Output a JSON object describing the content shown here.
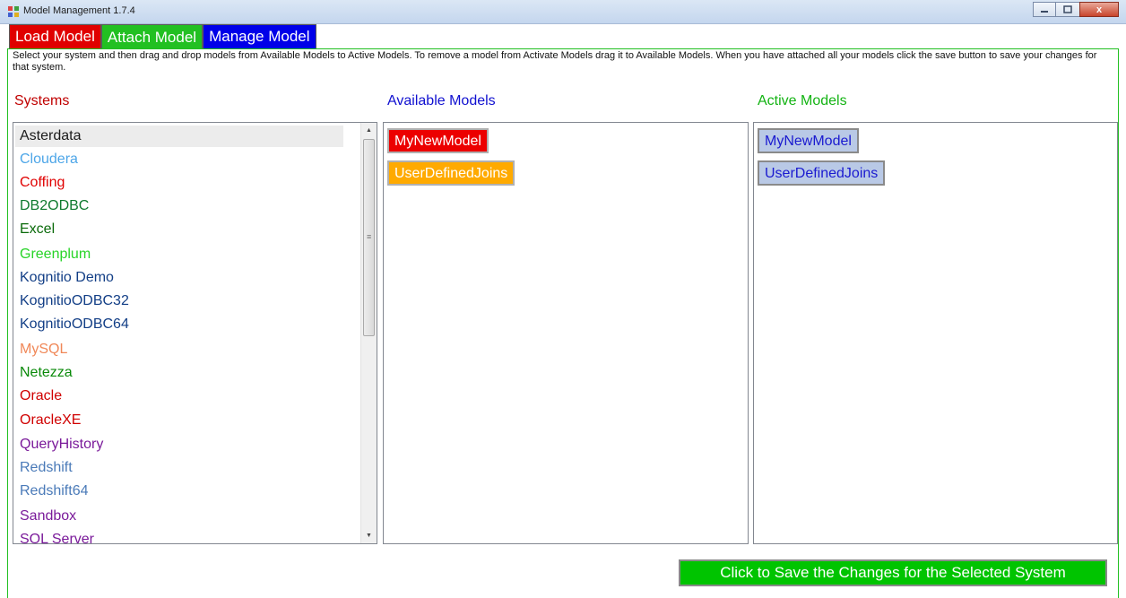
{
  "window": {
    "title": "Model Management 1.7.4",
    "minimize_icon": "minimize-icon",
    "maximize_icon": "maximize-icon",
    "close_icon": "close-icon",
    "close_label": "x"
  },
  "tabs": [
    {
      "label": "Load Model",
      "color": "#e00000"
    },
    {
      "label": "Attach Model",
      "color": "#22c022"
    },
    {
      "label": "Manage Model",
      "color": "#0000e8"
    }
  ],
  "instructions": "Select your system and then drag and drop models from Available Models to Active Models.  To remove a model from Activate Models drag it to Available Models.  When you have attached all your models click the save button to save your changes for that system.",
  "headers": {
    "systems": "Systems",
    "available": "Available Models",
    "active": "Active Models"
  },
  "systems": [
    {
      "label": "Asterdata",
      "color": "#1b1b1b",
      "selected": true
    },
    {
      "label": "Cloudera",
      "color": "#4da6e8"
    },
    {
      "label": "Coffing",
      "color": "#e00000"
    },
    {
      "label": "DB2ODBC",
      "color": "#0e7a2e"
    },
    {
      "label": "Excel",
      "color": "#0a6a0a"
    },
    {
      "label": "Greenplum",
      "color": "#28d428"
    },
    {
      "label": "Kognitio Demo",
      "color": "#123e86"
    },
    {
      "label": "KognitioODBC32",
      "color": "#123e86"
    },
    {
      "label": "KognitioODBC64",
      "color": "#123e86"
    },
    {
      "label": "MySQL",
      "color": "#f08858"
    },
    {
      "label": "Netezza",
      "color": "#0a8a0a"
    },
    {
      "label": "Oracle",
      "color": "#d00000"
    },
    {
      "label": "OracleXE",
      "color": "#d00000"
    },
    {
      "label": "QueryHistory",
      "color": "#7a1a9a"
    },
    {
      "label": "Redshift",
      "color": "#4a7ab8"
    },
    {
      "label": "Redshift64",
      "color": "#4a7ab8"
    },
    {
      "label": "Sandbox",
      "color": "#7a1a9a"
    },
    {
      "label": "SQL Server",
      "color": "#7a1a9a"
    }
  ],
  "available_models": [
    {
      "label": "MyNewModel",
      "style": "red"
    },
    {
      "label": "UserDefinedJoins",
      "style": "orange"
    }
  ],
  "active_models": [
    {
      "label": "MyNewModel",
      "style": "blue"
    },
    {
      "label": "UserDefinedJoins",
      "style": "blue"
    }
  ],
  "scrollbar": {
    "up_glyph": "▲",
    "down_glyph": "▼",
    "grip_glyph": "≡"
  },
  "save_button": "Click to Save the Changes for the Selected System"
}
